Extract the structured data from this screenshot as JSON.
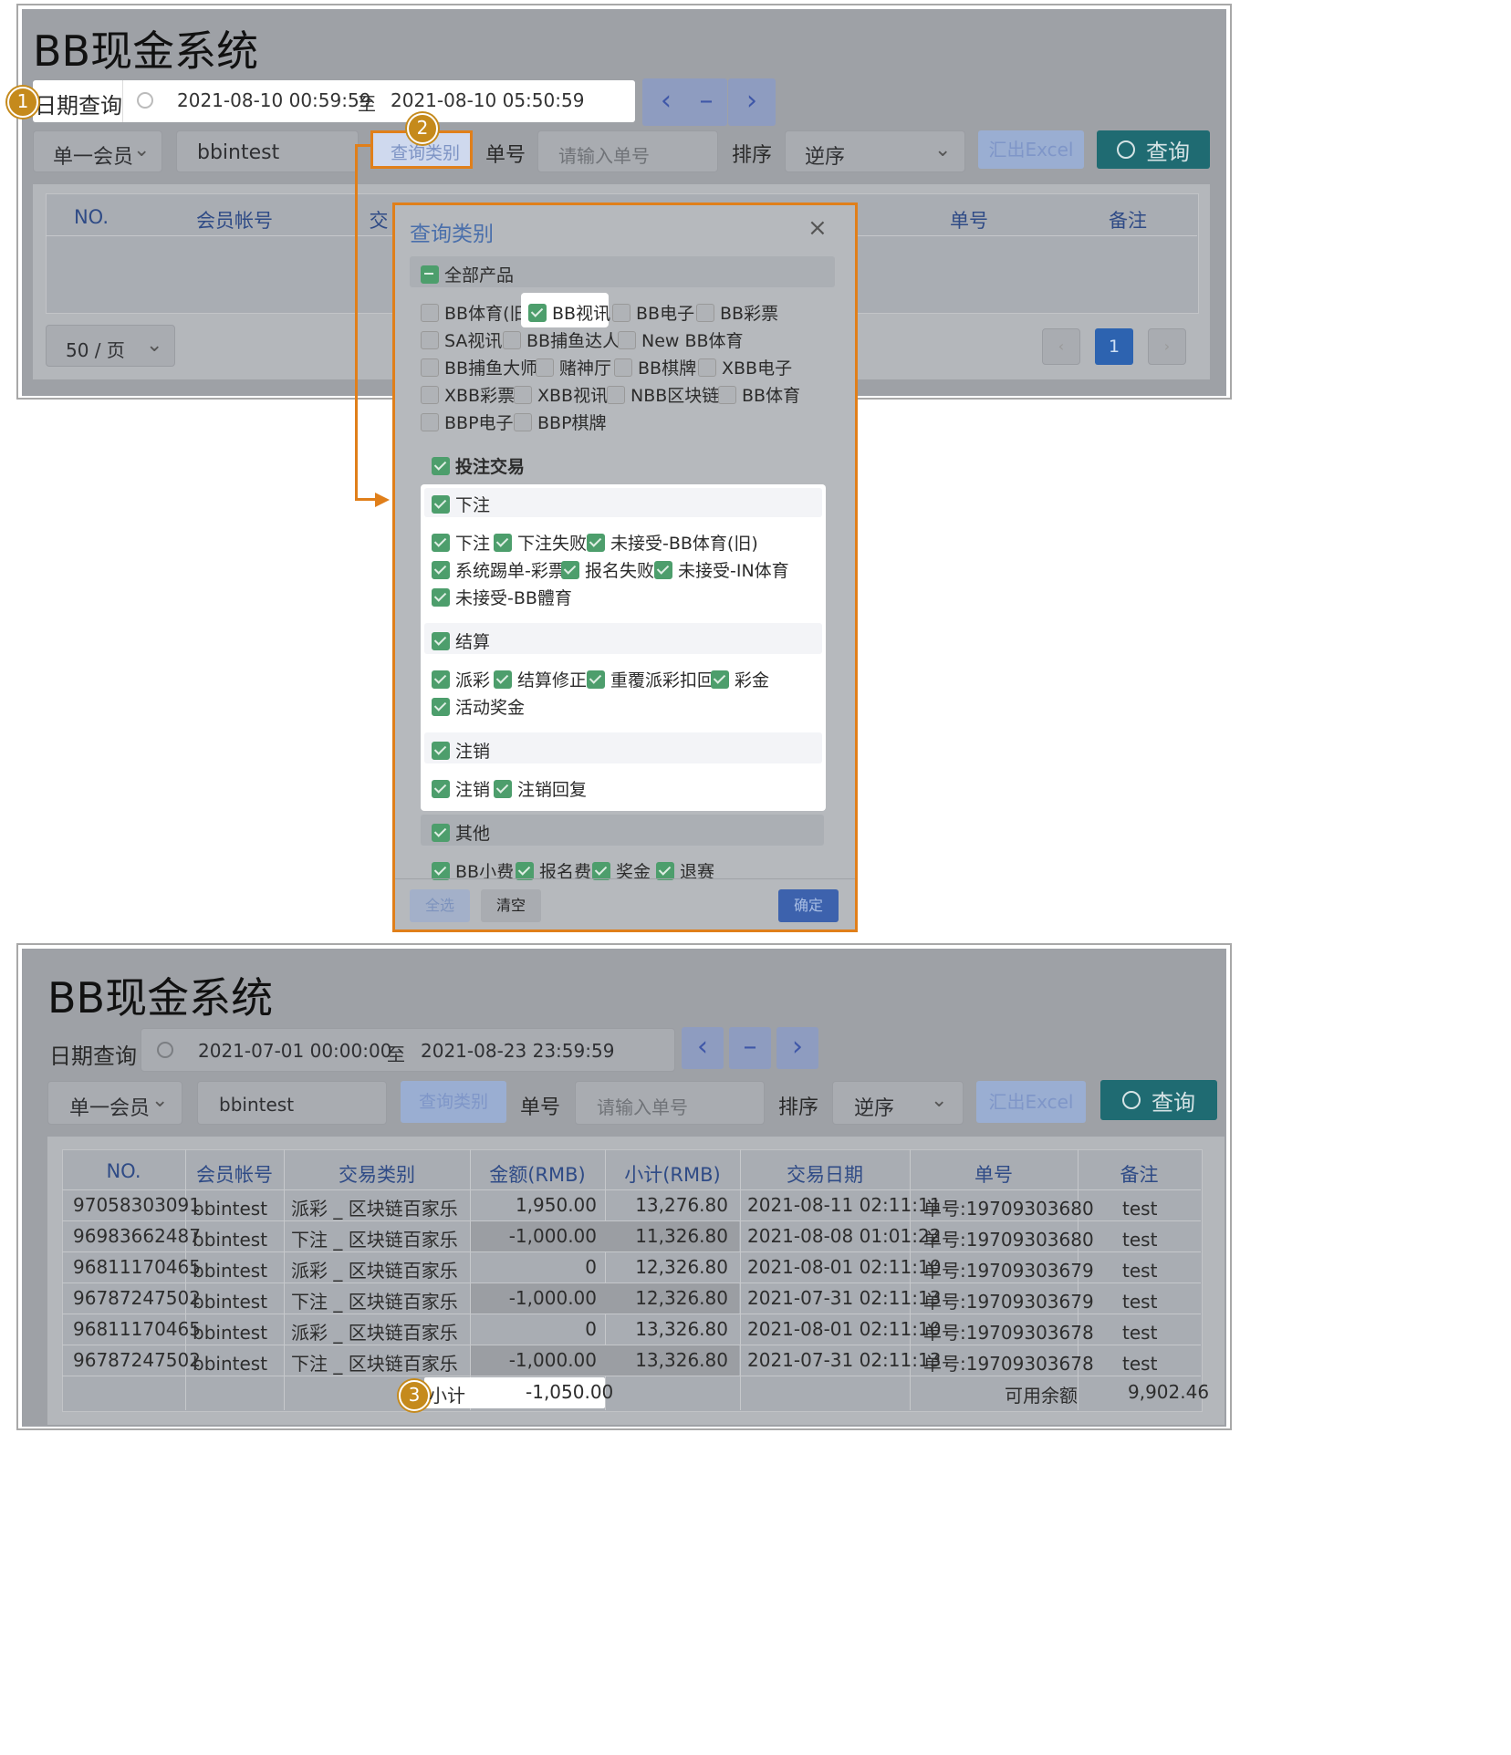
{
  "top": {
    "title": "BB现金系统",
    "date_label": "日期查询",
    "date_start": "2021-08-10 00:59:59",
    "date_sep": "至",
    "date_end": "2021-08-10 05:50:59",
    "member_select": "单一会员",
    "member_value": "bbintest",
    "query_type_button": "查询类别",
    "order_no_label": "单号",
    "order_no_placeholder": "请输入单号",
    "sort_label": "排序",
    "sort_value": "逆序",
    "excel_button": "汇出Excel",
    "query_button": "查询",
    "columns": [
      "NO.",
      "会员帐号",
      "交",
      "单号",
      "备注"
    ],
    "page_size": "50 / 页",
    "current_page": "1"
  },
  "badges": {
    "one": "1",
    "two": "2",
    "three": "3"
  },
  "popup": {
    "title": "查询类别",
    "all_products": "全部产品",
    "products": [
      [
        "BB体育(旧)",
        "BB视讯",
        "BB电子",
        "BB彩票"
      ],
      [
        "SA视讯",
        "BB捕鱼达人",
        "New BB体育"
      ],
      [
        "BB捕鱼大师",
        "赌神厅",
        "BB棋牌",
        "XBB电子"
      ],
      [
        "XBB彩票",
        "XBB视讯",
        "NBB区块链",
        "BB体育"
      ],
      [
        "BBP电子",
        "BBP棋牌"
      ]
    ],
    "bet_trade": "投注交易",
    "group_bet": "下注",
    "bet_items": [
      [
        "下注",
        "下注失败",
        "未接受-BB体育(旧)"
      ],
      [
        "系统踢单-彩票",
        "报名失败",
        "未接受-IN体育"
      ],
      [
        "未接受-BB體育"
      ]
    ],
    "group_settle": "结算",
    "settle_items": [
      [
        "派彩",
        "结算修正",
        "重覆派彩扣回",
        "彩金"
      ],
      [
        "活动奖金"
      ]
    ],
    "group_cancel": "注销",
    "cancel_items": [
      [
        "注销",
        "注销回复"
      ]
    ],
    "group_other": "其他",
    "other_items": [
      [
        "BB小费",
        "报名费",
        "奖金",
        "退赛"
      ]
    ],
    "btn_all": "全选",
    "btn_clear": "清空",
    "btn_ok": "确定"
  },
  "bottom": {
    "title": "BB现金系统",
    "date_label": "日期查询",
    "date_start": "2021-07-01 00:00:00",
    "date_sep": "至",
    "date_end": "2021-08-23 23:59:59",
    "member_select": "单一会员",
    "member_value": "bbintest",
    "query_type_button": "查询类别",
    "order_no_label": "单号",
    "order_no_placeholder": "请输入单号",
    "sort_label": "排序",
    "sort_value": "逆序",
    "excel_button": "汇出Excel",
    "query_button": "查询",
    "columns": [
      "NO.",
      "会员帐号",
      "交易类别",
      "金额(RMB)",
      "小计(RMB)",
      "交易日期",
      "单号",
      "备注"
    ],
    "rows": [
      [
        "97058303091",
        "bbintest",
        "派彩 _ 区块链百家乐",
        "1,950.00",
        "13,276.80",
        "2021-08-11 02:11:11",
        "单号:19709303680",
        "test"
      ],
      [
        "96983662487",
        "bbintest",
        "下注 _ 区块链百家乐",
        "-1,000.00",
        "11,326.80",
        "2021-08-08 01:01:22",
        "单号:19709303680",
        "test"
      ],
      [
        "96811170465",
        "bbintest",
        "派彩 _ 区块链百家乐",
        "0",
        "12,326.80",
        "2021-08-01 02:11:10",
        "单号:19709303679",
        "test"
      ],
      [
        "96787247502",
        "bbintest",
        "下注 _ 区块链百家乐",
        "-1,000.00",
        "12,326.80",
        "2021-07-31 02:11:13",
        "单号:19709303679",
        "test"
      ],
      [
        "96811170465",
        "bbintest",
        "派彩 _ 区块链百家乐",
        "0",
        "13,326.80",
        "2021-08-01 02:11:10",
        "单号:19709303678",
        "test"
      ],
      [
        "96787247502",
        "bbintest",
        "下注 _ 区块链百家乐",
        "-1,000.00",
        "13,326.80",
        "2021-07-31 02:11:13",
        "单号:19709303678",
        "test"
      ]
    ],
    "subtotal_label": "小计",
    "subtotal_value": "-1,050.00",
    "balance_label": "可用余额",
    "balance_value": "9,902.46"
  },
  "colors": {
    "accent_orange": "#e07f1a",
    "badge": "#c58a1c",
    "query_teal": "#1f6b72",
    "check_green": "#4d9e6c"
  }
}
